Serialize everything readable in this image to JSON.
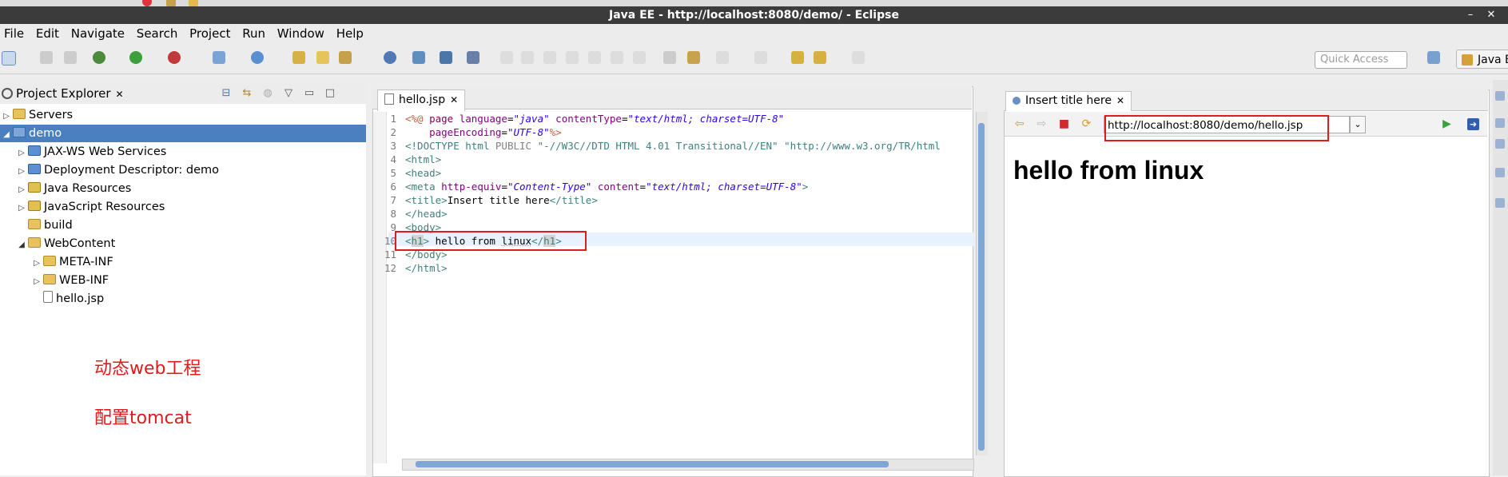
{
  "window": {
    "title": "Java EE - http://localhost:8080/demo/ - Eclipse",
    "minimize": "–",
    "close": "✕"
  },
  "menu": [
    "File",
    "Edit",
    "Navigate",
    "Search",
    "Project",
    "Run",
    "Window",
    "Help"
  ],
  "toolbar": {
    "quick_access_placeholder": "Quick Access",
    "perspective_label": "Java EE"
  },
  "project_explorer": {
    "tab_label": "Project Explorer",
    "close": "✕",
    "tree": [
      {
        "label": "Servers",
        "expander": "▷",
        "icon": "folder",
        "depth": 0
      },
      {
        "label": "demo",
        "expander": "◢",
        "icon": "project",
        "depth": 0,
        "selected": true
      },
      {
        "label": "JAX-WS Web Services",
        "expander": "▷",
        "icon": "ws",
        "depth": 1
      },
      {
        "label": "Deployment Descriptor: demo",
        "expander": "▷",
        "icon": "ws",
        "depth": 1
      },
      {
        "label": "Java Resources",
        "expander": "▷",
        "icon": "js",
        "depth": 1
      },
      {
        "label": "JavaScript Resources",
        "expander": "▷",
        "icon": "js",
        "depth": 1
      },
      {
        "label": "build",
        "expander": "",
        "icon": "folder",
        "depth": 1
      },
      {
        "label": "WebContent",
        "expander": "◢",
        "icon": "folder",
        "depth": 1
      },
      {
        "label": "META-INF",
        "expander": "▷",
        "icon": "folder",
        "depth": 2
      },
      {
        "label": "WEB-INF",
        "expander": "▷",
        "icon": "folder",
        "depth": 2
      },
      {
        "label": "hello.jsp",
        "expander": "",
        "icon": "file",
        "depth": 2
      }
    ]
  },
  "annotations": [
    "动态web工程",
    "配置tomcat"
  ],
  "editor": {
    "tab_label": "hello.jsp",
    "close": "✕",
    "line_numbers": [
      "1",
      "2",
      "3",
      "4",
      "5",
      "6",
      "7",
      "8",
      "9",
      "10",
      "11",
      "12"
    ],
    "code": {
      "l1": [
        "<%@",
        " page ",
        "language",
        "=",
        "\"java\"",
        " ",
        "contentType",
        "=",
        "\"text/html; charset=UTF-8\""
      ],
      "l2": [
        "    ",
        "pageEncoding",
        "=",
        "\"UTF-8\"",
        "%>"
      ],
      "l3": [
        "<!DOCTYPE html ",
        "PUBLIC",
        " ",
        "\"-//W3C//DTD HTML 4.01 Transitional//EN\"",
        " ",
        "\"http://www.w3.org/TR/html"
      ],
      "l4": [
        "<html>"
      ],
      "l5": [
        "<head>"
      ],
      "l6": [
        "<",
        "meta",
        " ",
        "http-equiv",
        "=",
        "\"Content-Type\"",
        " ",
        "content",
        "=",
        "\"text/html; charset=UTF-8\"",
        ">"
      ],
      "l7": [
        "<",
        "title",
        ">",
        "Insert title here",
        "</",
        "title",
        ">"
      ],
      "l8": [
        "</head>"
      ],
      "l9": [
        "<body>"
      ],
      "l10": [
        "<",
        "h1",
        ">",
        " hello from ",
        "linux",
        "</",
        "h1",
        ">"
      ],
      "l11": [
        "</body>"
      ],
      "l12": [
        "</html>"
      ]
    }
  },
  "browser": {
    "tab_label": "Insert title here",
    "close": "✕",
    "url": "http://localhost:8080/demo/hello.jsp",
    "dropdown": "⌄",
    "heading": "hello from linux"
  },
  "colors": {
    "selection": "#4a7fc0",
    "annotation_red": "#e01b1b",
    "tag": "#3f7f7f",
    "attribute": "#7f007f",
    "string": "#2a00ff",
    "keyword": "#7f0055"
  }
}
